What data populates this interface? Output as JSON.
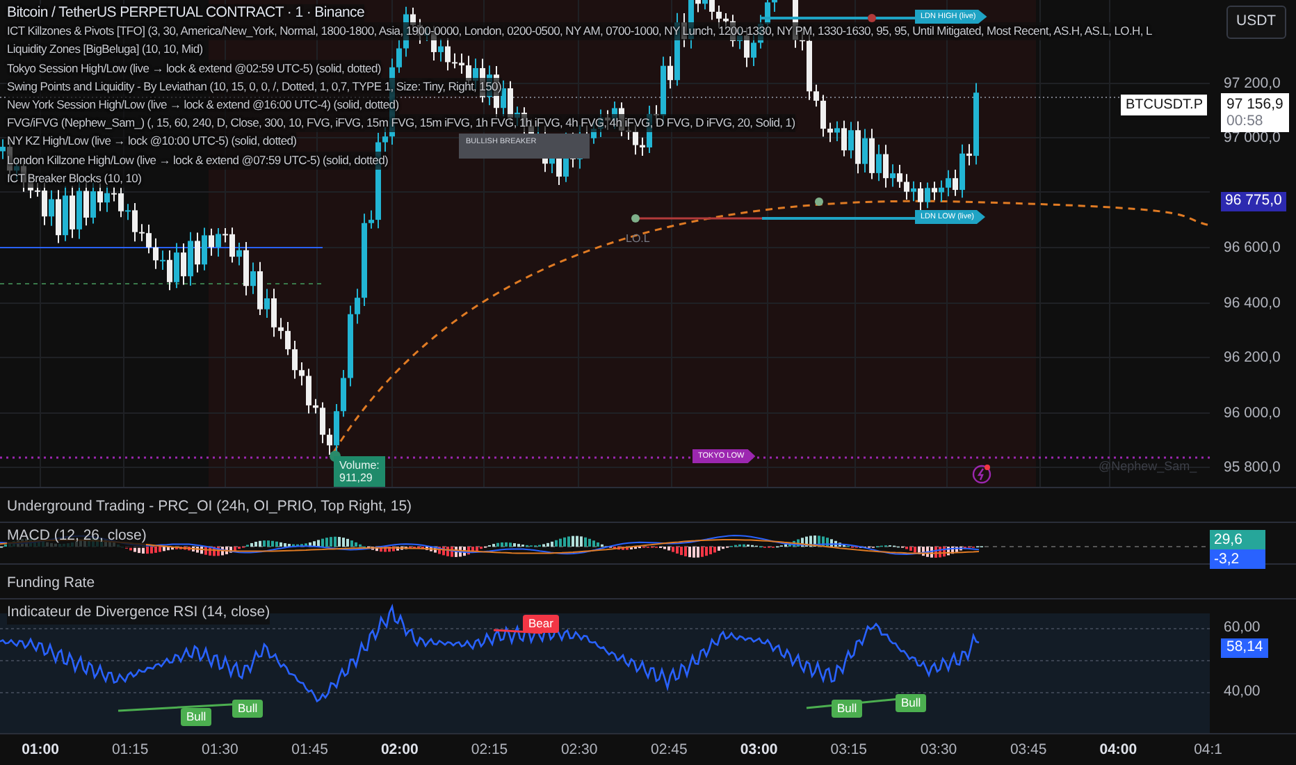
{
  "legend": {
    "symbol": "Bitcoin / TetherUS PERPETUAL CONTRACT · 1 · Binance",
    "indicators": [
      "ICT Killzones & Pivots [TFO] (3, 30, America/New_York, Normal, 1800-1800, Asia, 1900-0000, London, 0200-0500, NY AM, 0700-1000, NY Lunch, 1200-1330, NY PM, 1330-1630, 95, 95, Until Mitigated, Most Recent, AS.H, AS.L, LO.H, L",
      "Liquidity Zones [BigBeluga] (10, 10, Mid)",
      "Tokyo Session High/Low (live → lock & extend @02:59 UTC-5) (solid, dotted)",
      "Swing Points and Liquidity - By Leviathan (10, 15, 0, 0, /, Dotted, 1, 0,7, TYPE 1, Size: Tiny, Right, 150)",
      "New York Session High/Low (live → lock & extend @16:00 UTC-4) (solid, dotted)",
      "FVG/iFVG (Nephew_Sam_) (, 15, 60, 240, D, Close, 300, 10, FVG, iFVG, 15m FVG, 15m iFVG, 1h FVG, 1h iFVG, 4h FVG, 4h iFVG, D FVG, D iFVG, 20, Solid, 1)",
      "NY KZ High/Low (live → lock @10:00 UTC-5) (solid, dotted)",
      "London Killzone High/Low (live → lock & extend @07:59 UTC-5) (solid, dotted)",
      "ICT Breaker Blocks (10, 10)"
    ]
  },
  "chart_labels": [
    {
      "text": "LDN HIGH (live)",
      "kind": "session",
      "color": "#1fa3c4"
    },
    {
      "text": "LDN LOW (live)",
      "kind": "session",
      "color": "#1fa3c4"
    },
    {
      "text": "TOKYO LOW",
      "kind": "session",
      "color": "#9c27b0"
    },
    {
      "text": "LO.L",
      "kind": "swing"
    },
    {
      "text": "BULLISH BREAKER",
      "kind": "breaker"
    },
    {
      "text": "Volume:\n911,29",
      "kind": "volume"
    },
    {
      "text": "@Nephew_Sam_",
      "kind": "signature"
    }
  ],
  "price_axis": {
    "currency_button": "USDT",
    "ticks": [
      "97 200,0",
      "97 000,0",
      "96 600,0",
      "96 400,0",
      "96 200,0",
      "96 000,0",
      "95 800,0"
    ],
    "last_price": {
      "symbol": "BTCUSDT.P",
      "price": "97 156,9",
      "countdown": "00:58"
    },
    "marker": "96 775,0"
  },
  "panels": [
    {
      "kind": "text",
      "title": "Underground Trading - PRC_OI (24h, OI_PRIO, Top Right, 15)"
    },
    {
      "kind": "macd",
      "title": "MACD (12, 26, close)",
      "values": [
        "29,6",
        "-3,2"
      ]
    },
    {
      "kind": "text",
      "title": "Funding Rate"
    },
    {
      "kind": "rsi",
      "title": "Indicateur de Divergence RSI (14, close)",
      "ticks": [
        "60,00",
        "40,00"
      ],
      "value": "58,14",
      "signals": [
        {
          "text": "Bull",
          "kind": "bull"
        },
        {
          "text": "Bull",
          "kind": "bull"
        },
        {
          "text": "Bear",
          "kind": "bear"
        },
        {
          "text": "Bull",
          "kind": "bull"
        },
        {
          "text": "Bull",
          "kind": "bull"
        }
      ]
    }
  ],
  "time_axis": [
    {
      "label": "01:00",
      "major": true
    },
    {
      "label": "01:15",
      "major": false
    },
    {
      "label": "01:30",
      "major": false
    },
    {
      "label": "01:45",
      "major": false
    },
    {
      "label": "02:00",
      "major": true
    },
    {
      "label": "02:15",
      "major": false
    },
    {
      "label": "02:30",
      "major": false
    },
    {
      "label": "02:45",
      "major": false
    },
    {
      "label": "03:00",
      "major": true
    },
    {
      "label": "03:15",
      "major": false
    },
    {
      "label": "03:30",
      "major": false
    },
    {
      "label": "03:45",
      "major": false
    },
    {
      "label": "04:00",
      "major": true
    },
    {
      "label": "04:1",
      "major": false
    }
  ]
}
